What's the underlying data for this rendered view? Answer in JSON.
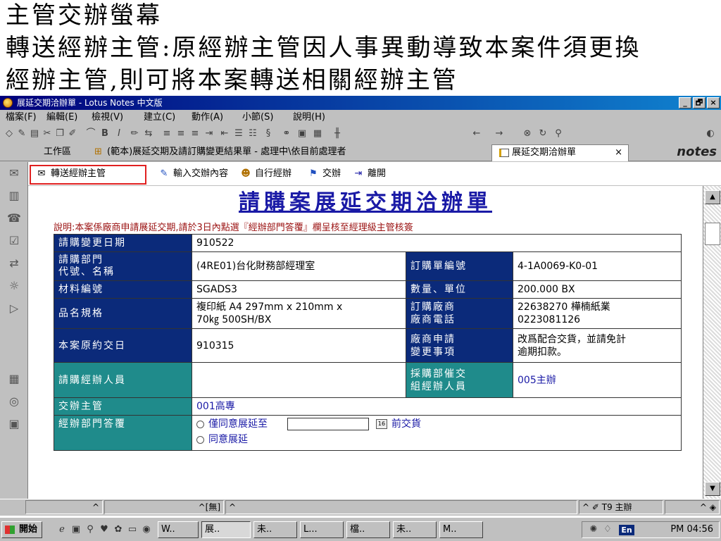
{
  "slide": {
    "line1": "主管交辦螢幕",
    "line2": "轉送經辦主管:原經辦主管因人事異動導致本案件須更換",
    "line3": "經辦主管,則可將本案轉送相關經辦主管"
  },
  "window": {
    "title": "展延交期洽辦單 - Lotus Notes 中文版",
    "controls": {
      "minimize": "_",
      "restore": "🗗",
      "close": "×"
    }
  },
  "menu": [
    "檔案(F)",
    "編輯(E)",
    "檢視(V)",
    "建立(C)",
    "動作(A)",
    "小節(S)",
    "說明(H)"
  ],
  "tabs": {
    "workspace": "工作區",
    "inbox_view": "(範本)展延交期及請訂購變更結果單 - 處理中\\依目前處理者",
    "active": "展延交期洽辦單",
    "active_close": "×",
    "brand": "notes"
  },
  "actions": [
    {
      "label": "轉送經辦主管",
      "icon": "✉"
    },
    {
      "label": "輸入交辦內容",
      "icon": "✎"
    },
    {
      "label": "自行經辦",
      "icon": "☻"
    },
    {
      "label": "交辦",
      "icon": "⚑"
    },
    {
      "label": "離開",
      "icon": "⇥"
    }
  ],
  "document": {
    "title": "請購案展延交期洽辦單",
    "note": "說明:本案係廠商申請展延交期,請於3日內點選『經辦部門答覆』欄呈核至經理級主管核簽",
    "rows": {
      "change_date_label": "請購變更日期",
      "change_date_value": "910522",
      "dept_label_1": "請購部門",
      "dept_label_2": "代號、名稱",
      "dept_value": "(4RE01)台化財務部經理室",
      "po_label": "訂購單編號",
      "po_value": "4-1A0069-K0-01",
      "material_label": "材料編號",
      "material_value": "SGADS3",
      "qty_label": "數量、單位",
      "qty_value": "200.000 BX",
      "spec_label": "品名規格",
      "spec_value_1": "複印紙 A4 297mm x 210mm x",
      "spec_value_2": "70㎏ 500SH/BX",
      "vendor_label_1": "訂購廠商",
      "vendor_label_2": "廠商電話",
      "vendor_value_1": "22638270 樺楠紙業",
      "vendor_value_2": "0223081126",
      "orig_date_label": "本案原約交日",
      "orig_date_value": "910315",
      "request_label_1": "廠商申請",
      "request_label_2": "變更事項",
      "request_value_1": "改爲配合交貨，並請免計",
      "request_value_2": "逾期扣款。",
      "handler_label": "請購經辦人員",
      "handler_value": "",
      "buyer_label_1": "採購部催交",
      "buyer_label_2": "組經辦人員",
      "buyer_value": "005主辦",
      "supervisor_label": "交辦主管",
      "supervisor_value": "001高專",
      "reply_label": "經辦部門答覆",
      "reply_option_1": "僅同意展延至",
      "reply_cal": "16",
      "reply_suffix": "前交貨",
      "reply_option_2": "同意展延"
    }
  },
  "statusbar": {
    "left_arrow": "^",
    "seg2": "^[無]",
    "seg3": "^",
    "right_user": "^ ✐ T9 主辦",
    "right_icon": "^ ◈"
  },
  "taskbar": {
    "start": "開始",
    "tasks": [
      "W..",
      "展..",
      "未..",
      "L...",
      "檔..",
      "未..",
      "M.."
    ],
    "lang": "En",
    "clock": "PM 04:56"
  },
  "colors": {
    "label_navy": "#0b2a7a",
    "label_teal": "#1f8b8b",
    "title_blue": "#1a1aa6",
    "note_red": "#9a1010",
    "highlight_red": "#e02020"
  }
}
